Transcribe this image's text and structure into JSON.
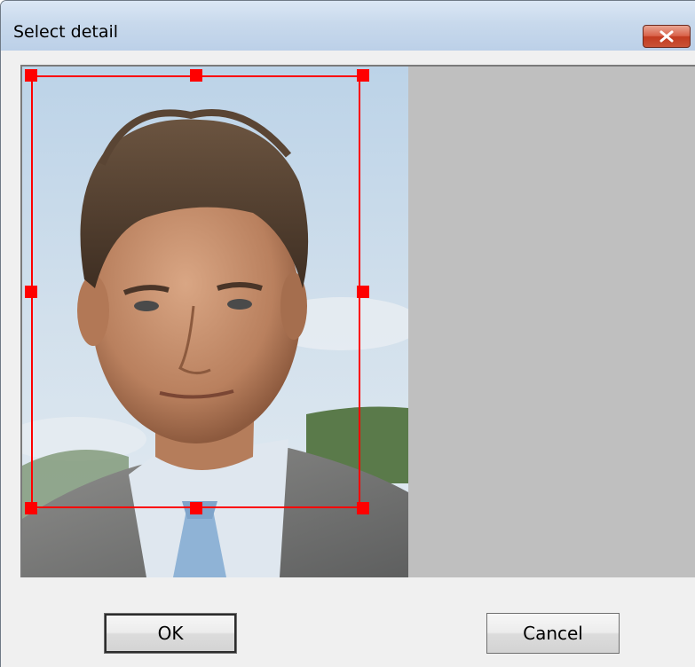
{
  "window": {
    "title": "Select detail",
    "close_icon": "close-x-icon"
  },
  "image": {
    "subject": "portrait-photo",
    "selection": {
      "color": "#ff0000",
      "handles": [
        "top-left",
        "top-center",
        "top-right",
        "middle-left",
        "middle-right",
        "bottom-left",
        "bottom-center",
        "bottom-right"
      ]
    }
  },
  "buttons": {
    "ok": {
      "mnemonic": "O",
      "rest": "K"
    },
    "cancel": {
      "mnemonic": "C",
      "rest": "ancel"
    }
  },
  "colors": {
    "selection": "#ff0000",
    "frame_background": "#bfbfbf",
    "dialog_background": "#f0f0f0"
  }
}
